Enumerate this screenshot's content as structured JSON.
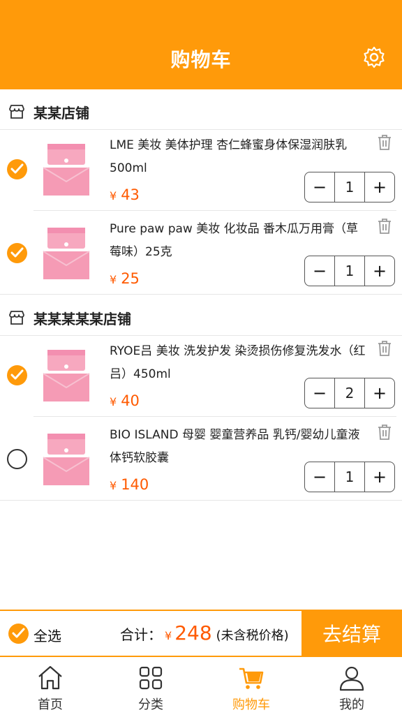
{
  "header": {
    "title": "购物车",
    "settings_icon": "gear-icon"
  },
  "accent_color": "#ff9a0a",
  "price_color": "#ff5a00",
  "stores": [
    {
      "name": "某某店铺",
      "items": [
        {
          "title": "LME 美妆 美体护理 杏仁蜂蜜身体保湿润肤乳500ml",
          "currency": "¥",
          "price": "43",
          "qty": "1",
          "checked": true
        },
        {
          "title": "Pure paw paw 美妆 化妆品 番木瓜万用膏（草莓味）25克",
          "currency": "¥",
          "price": "25",
          "qty": "1",
          "checked": true
        }
      ]
    },
    {
      "name": "某某某某某店铺",
      "items": [
        {
          "title": "RYOE吕 美妆 洗发护发 染烫损伤修复洗发水（红吕）450ml",
          "currency": "¥",
          "price": "40",
          "qty": "2",
          "checked": true
        },
        {
          "title": "BIO ISLAND 母婴 婴童营养品 乳钙/婴幼儿童液体钙软胶囊",
          "currency": "¥",
          "price": "140",
          "qty": "1",
          "checked": false
        }
      ]
    }
  ],
  "stepper": {
    "minus": "−",
    "plus": "+"
  },
  "checkout": {
    "select_all": "全选",
    "total_label": "合计：",
    "currency": "¥",
    "total": "248",
    "tax_note": "(未含税价格)",
    "pay_button": "去结算"
  },
  "tabbar": [
    {
      "label": "首页",
      "icon": "home-icon"
    },
    {
      "label": "分类",
      "icon": "category-grid-icon"
    },
    {
      "label": "购物车",
      "icon": "cart-icon",
      "active": true
    },
    {
      "label": "我的",
      "icon": "profile-icon"
    }
  ]
}
